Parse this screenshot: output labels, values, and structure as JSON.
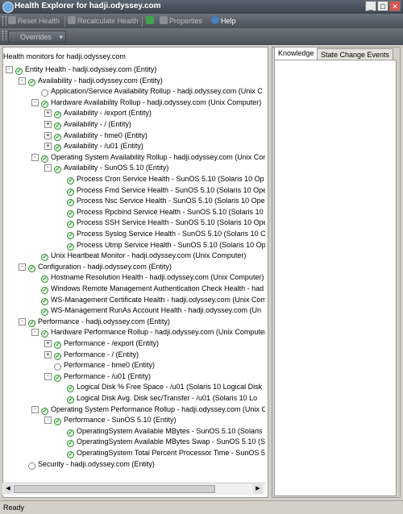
{
  "window": {
    "title": "Health Explorer for hadji.odyssey.com",
    "min": "_",
    "max": "□",
    "close": "✕"
  },
  "toolbar": {
    "reset_health": "Reset Health",
    "recalculate_health": "Recalculate Health",
    "properties": "Properties",
    "help": "Help",
    "overrides": "Overrides"
  },
  "left_pane": {
    "header": "Health monitors for hadji.odyssey.com"
  },
  "tree": [
    {
      "label": "Entity Health - hadji.odyssey.com (Entity)",
      "depth": 0,
      "exp": "-"
    },
    {
      "label": "Availability - hadji.odyssey.com (Entity)",
      "depth": 1,
      "exp": "-"
    },
    {
      "label": "Application/Service Availability Rollup - hadji.odyssey.com (Unix C",
      "depth": 2,
      "exp": "",
      "empty": true
    },
    {
      "label": "Hardware Availability Rollup - hadji.odyssey.com (Unix Computer)",
      "depth": 2,
      "exp": "-"
    },
    {
      "label": "Availability - /export (Entity)",
      "depth": 3,
      "exp": "+"
    },
    {
      "label": "Availability - / (Entity)",
      "depth": 3,
      "exp": "+"
    },
    {
      "label": "Availability - hme0 (Entity)",
      "depth": 3,
      "exp": "+"
    },
    {
      "label": "Availability - /u01 (Entity)",
      "depth": 3,
      "exp": "+"
    },
    {
      "label": "Operating System Availability Rollup - hadji.odyssey.com (Unix Con",
      "depth": 2,
      "exp": "-"
    },
    {
      "label": "Availability - SunOS 5.10 (Entity)",
      "depth": 3,
      "exp": "-"
    },
    {
      "label": "Process Cron Service Health - SunOS 5.10 (Solaris 10 Op",
      "depth": 4,
      "exp": ""
    },
    {
      "label": "Process Fmd Service Health - SunOS 5.10 (Solaris 10 Ope",
      "depth": 4,
      "exp": ""
    },
    {
      "label": "Process Nsc Service Health - SunOS 5.10 (Solaris 10 Ope",
      "depth": 4,
      "exp": ""
    },
    {
      "label": "Process Rpcbind Service Health - SunOS 5.10 (Solaris 10",
      "depth": 4,
      "exp": ""
    },
    {
      "label": "Process SSH Service Health - SunOS 5.10 (Solaris 10 Ope",
      "depth": 4,
      "exp": ""
    },
    {
      "label": "Process Syslog Service Health - SunOS 5.10 (Solaris 10 C",
      "depth": 4,
      "exp": ""
    },
    {
      "label": "Process Utmp Service Health - SunOS 5.10 (Solaris 10 Op",
      "depth": 4,
      "exp": ""
    },
    {
      "label": "Unix Heartbeat Monitor - hadji.odyssey.com (Unix Computer)",
      "depth": 2,
      "exp": ""
    },
    {
      "label": "Configuration - hadji.odyssey.com (Entity)",
      "depth": 1,
      "exp": "-"
    },
    {
      "label": "Hostname Resolution Health - hadji.odyssey.com (Unix Computer)",
      "depth": 2,
      "exp": ""
    },
    {
      "label": "Windows Remote Management Authentication Check Health - had",
      "depth": 2,
      "exp": ""
    },
    {
      "label": "WS-Management Certificate Health - hadji.odyssey.com (Unix Com",
      "depth": 2,
      "exp": ""
    },
    {
      "label": "WS-Management RunAs Account Health - hadji.odyssey.com (Un",
      "depth": 2,
      "exp": ""
    },
    {
      "label": "Performance - hadji.odyssey.com (Entity)",
      "depth": 1,
      "exp": "-"
    },
    {
      "label": "Hardware Performance Rollup - hadji.odyssey.com (Unix Computer",
      "depth": 2,
      "exp": "-"
    },
    {
      "label": "Performance - /export (Entity)",
      "depth": 3,
      "exp": "+"
    },
    {
      "label": "Performance - / (Entity)",
      "depth": 3,
      "exp": "+"
    },
    {
      "label": "Performance - hme0 (Entity)",
      "depth": 3,
      "exp": "",
      "empty": true
    },
    {
      "label": "Performance - /u01 (Entity)",
      "depth": 3,
      "exp": "-"
    },
    {
      "label": "Logical Disk % Free Space - /u01 (Solaris 10 Logical Disk",
      "depth": 4,
      "exp": ""
    },
    {
      "label": "Logical Disk Avg. Disk sec/Transfer - /u01 (Solaris 10 Lo",
      "depth": 4,
      "exp": ""
    },
    {
      "label": "Operating System Performance Rollup - hadji.odyssey.com (Unix C",
      "depth": 2,
      "exp": "-"
    },
    {
      "label": "Performance - SunOS 5.10 (Entity)",
      "depth": 3,
      "exp": "-"
    },
    {
      "label": "OperatingSystem Available MBytes - SunOS 5.10 (Solaris",
      "depth": 4,
      "exp": ""
    },
    {
      "label": "OperatingSystem Available MBytes Swap - SunOS 5.10 (S",
      "depth": 4,
      "exp": ""
    },
    {
      "label": "OperatingSystem Total Percent Processor Time - SunOS 5",
      "depth": 4,
      "exp": ""
    },
    {
      "label": "Security - hadji.odyssey.com (Entity)",
      "depth": 1,
      "exp": "",
      "empty": true
    }
  ],
  "right_pane": {
    "tabs": [
      "Knowledge",
      "State Change Events"
    ]
  },
  "status": "Ready"
}
